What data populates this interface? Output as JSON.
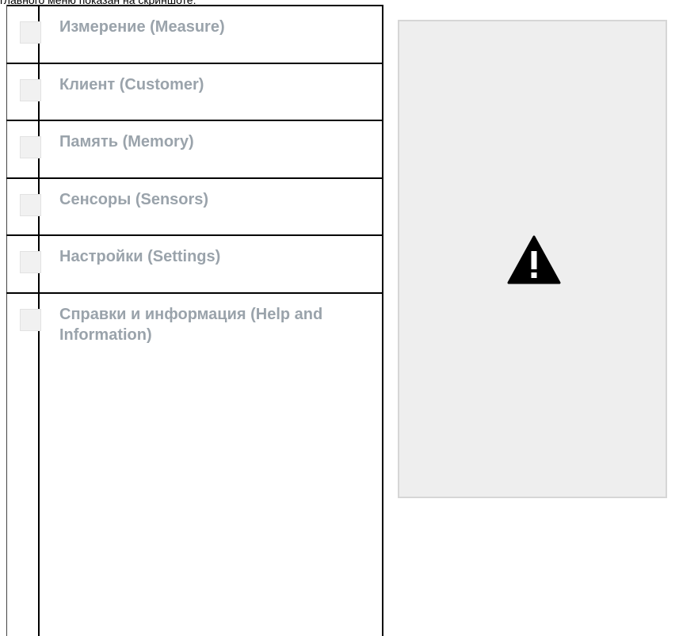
{
  "caption": "главного меню показан на скриншоте:",
  "menu": {
    "items": [
      {
        "label": "Измерение (Measure)"
      },
      {
        "label": "Клиент (Customer)"
      },
      {
        "label": "Память (Memory)"
      },
      {
        "label": "Сенсоры (Sensors)"
      },
      {
        "label": "Настройки (Settings)"
      },
      {
        "label": "Справки и информация (Help and  Information)"
      }
    ]
  },
  "image_placeholder": {
    "icon": "warning-icon",
    "background": "#eeeeee",
    "icon_color": "#000000"
  }
}
